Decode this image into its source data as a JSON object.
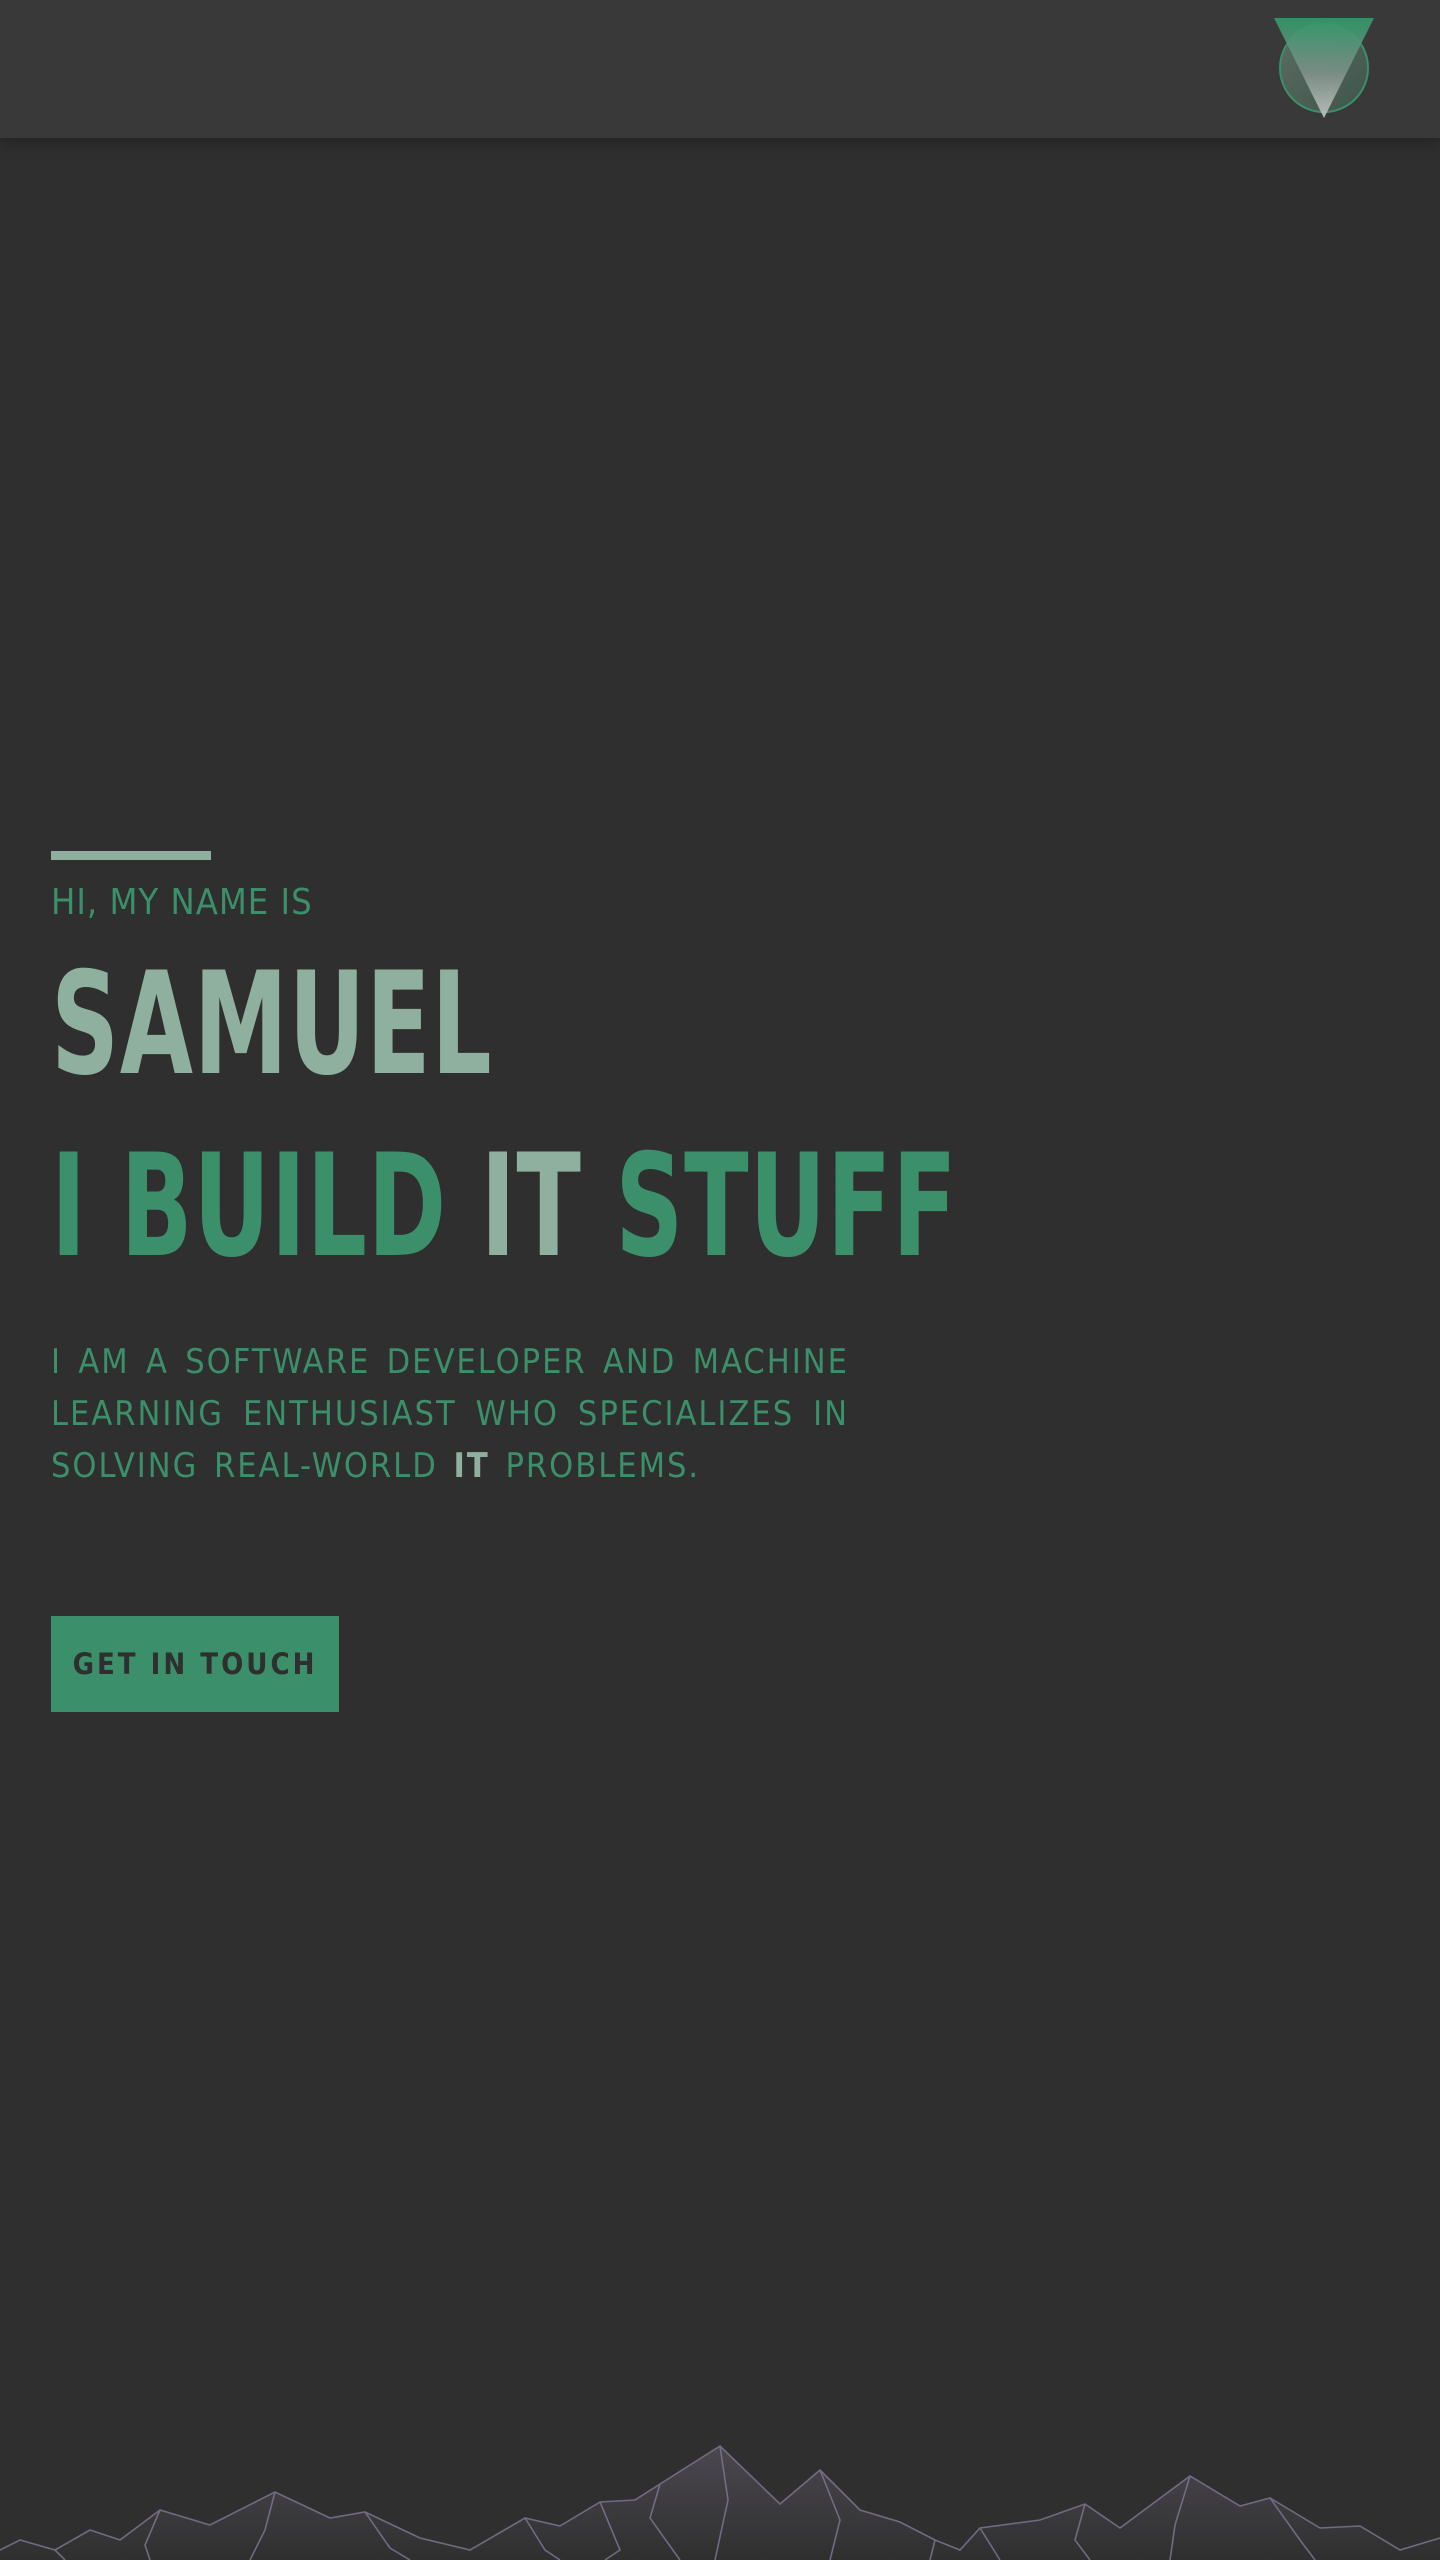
{
  "hero": {
    "greeting": "HI, MY NAME IS",
    "name": "SAMUEL",
    "tagline_before": "I BUILD ",
    "tagline_highlight": "IT",
    "tagline_after": " STUFF",
    "bio_before": "I AM A SOFTWARE DEVELOPER AND MACHINE LEARNING ENTHUSIAST WHO SPECIALIZES IN SOLVING REAL-WORLD ",
    "bio_highlight": "IT",
    "bio_after": " PROBLEMS.",
    "cta_label": "GET IN TOUCH"
  },
  "icons": {
    "logo": "triangle-circle-logo-icon",
    "footer_art": "mountain-range-illustration"
  },
  "colors": {
    "background": "#2f2f2f",
    "header": "#393939",
    "accent_green": "#3b8f6a",
    "accent_sage": "#8fb09f",
    "mountain_stroke": "#7c7490"
  }
}
